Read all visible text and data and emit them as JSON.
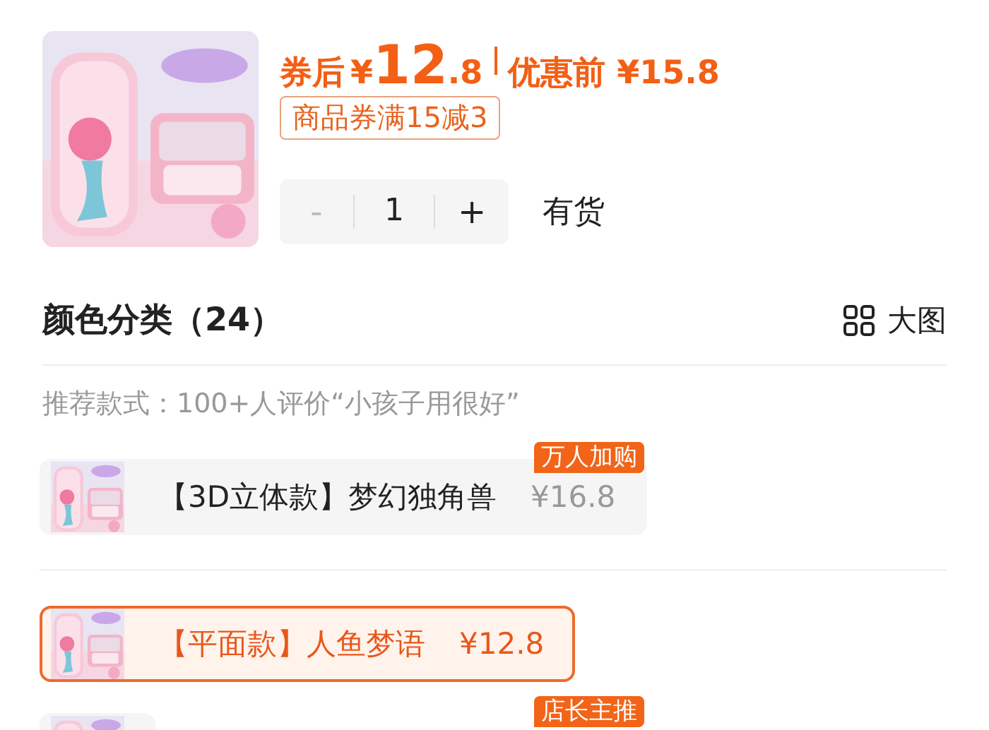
{
  "product": {
    "price": {
      "prefix": "券后",
      "currency": "¥",
      "integer": "12",
      "decimal": ".8"
    },
    "original_price": "优惠前 ¥15.8",
    "coupon": "商品券满15减3",
    "quantity": {
      "minus": "-",
      "value": "1",
      "plus": "+",
      "disabled_minus": true
    },
    "stock": "有货"
  },
  "section": {
    "title": "颜色分类（24）",
    "view_toggle": "大图",
    "hint": "推荐款式：100+人评价“小孩子用很好”"
  },
  "options": [
    {
      "name": "【3D立体款】梦幻独角兽",
      "price": "¥16.8",
      "badge": "万人加购",
      "selected": false
    },
    {
      "name": "【平面款】人鱼梦语",
      "price": "¥12.8",
      "selected": true
    },
    {
      "badge": "店长主推",
      "selected": false
    }
  ]
}
